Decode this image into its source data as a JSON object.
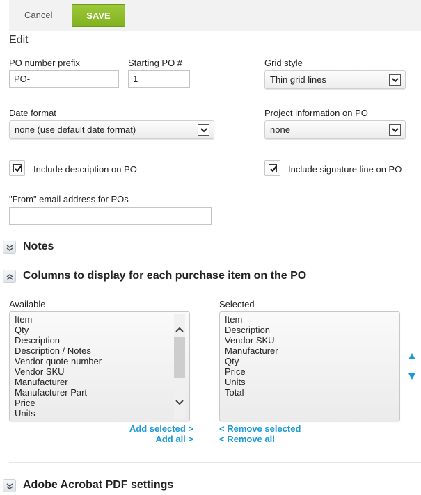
{
  "toolbar": {
    "cancel_label": "Cancel",
    "save_label": "SAVE"
  },
  "edit_title": "Edit",
  "fields": {
    "po_prefix": {
      "label": "PO number prefix",
      "value": "PO-"
    },
    "starting_po": {
      "label": "Starting PO #",
      "value": "1"
    },
    "grid_style": {
      "label": "Grid style",
      "value": "Thin grid lines"
    },
    "date_format": {
      "label": "Date format",
      "value": "none (use default date format)"
    },
    "project_info": {
      "label": "Project information on PO",
      "value": "none"
    },
    "include_description": {
      "label": "Include description on PO",
      "checked": true
    },
    "include_signature": {
      "label": "Include signature line on PO",
      "checked": true
    },
    "from_email": {
      "label": "\"From\" email address for POs",
      "value": ""
    }
  },
  "sections": {
    "notes": {
      "title": "Notes",
      "state": "collapsed"
    },
    "columns": {
      "title": "Columns to display for each purchase item on the PO",
      "state": "expanded"
    },
    "pdf": {
      "title": "Adobe Acrobat PDF settings",
      "state": "collapsed"
    }
  },
  "columns": {
    "available_label": "Available",
    "selected_label": "Selected",
    "available": [
      "Item",
      "Qty",
      "Description",
      "Description / Notes",
      "Vendor quote number",
      "Vendor SKU",
      "Manufacturer",
      "Manufacturer Part",
      "Price",
      "Units"
    ],
    "selected": [
      "Item",
      "Description",
      "Vendor SKU",
      "Manufacturer",
      "Qty",
      "Price",
      "Units",
      "Total"
    ],
    "add_selected": "Add selected >",
    "add_all": "Add all >",
    "remove_selected": "< Remove selected",
    "remove_all": "< Remove all"
  },
  "colors": {
    "save_green": "#8cbc2a",
    "link_blue": "#1a9ad6"
  }
}
